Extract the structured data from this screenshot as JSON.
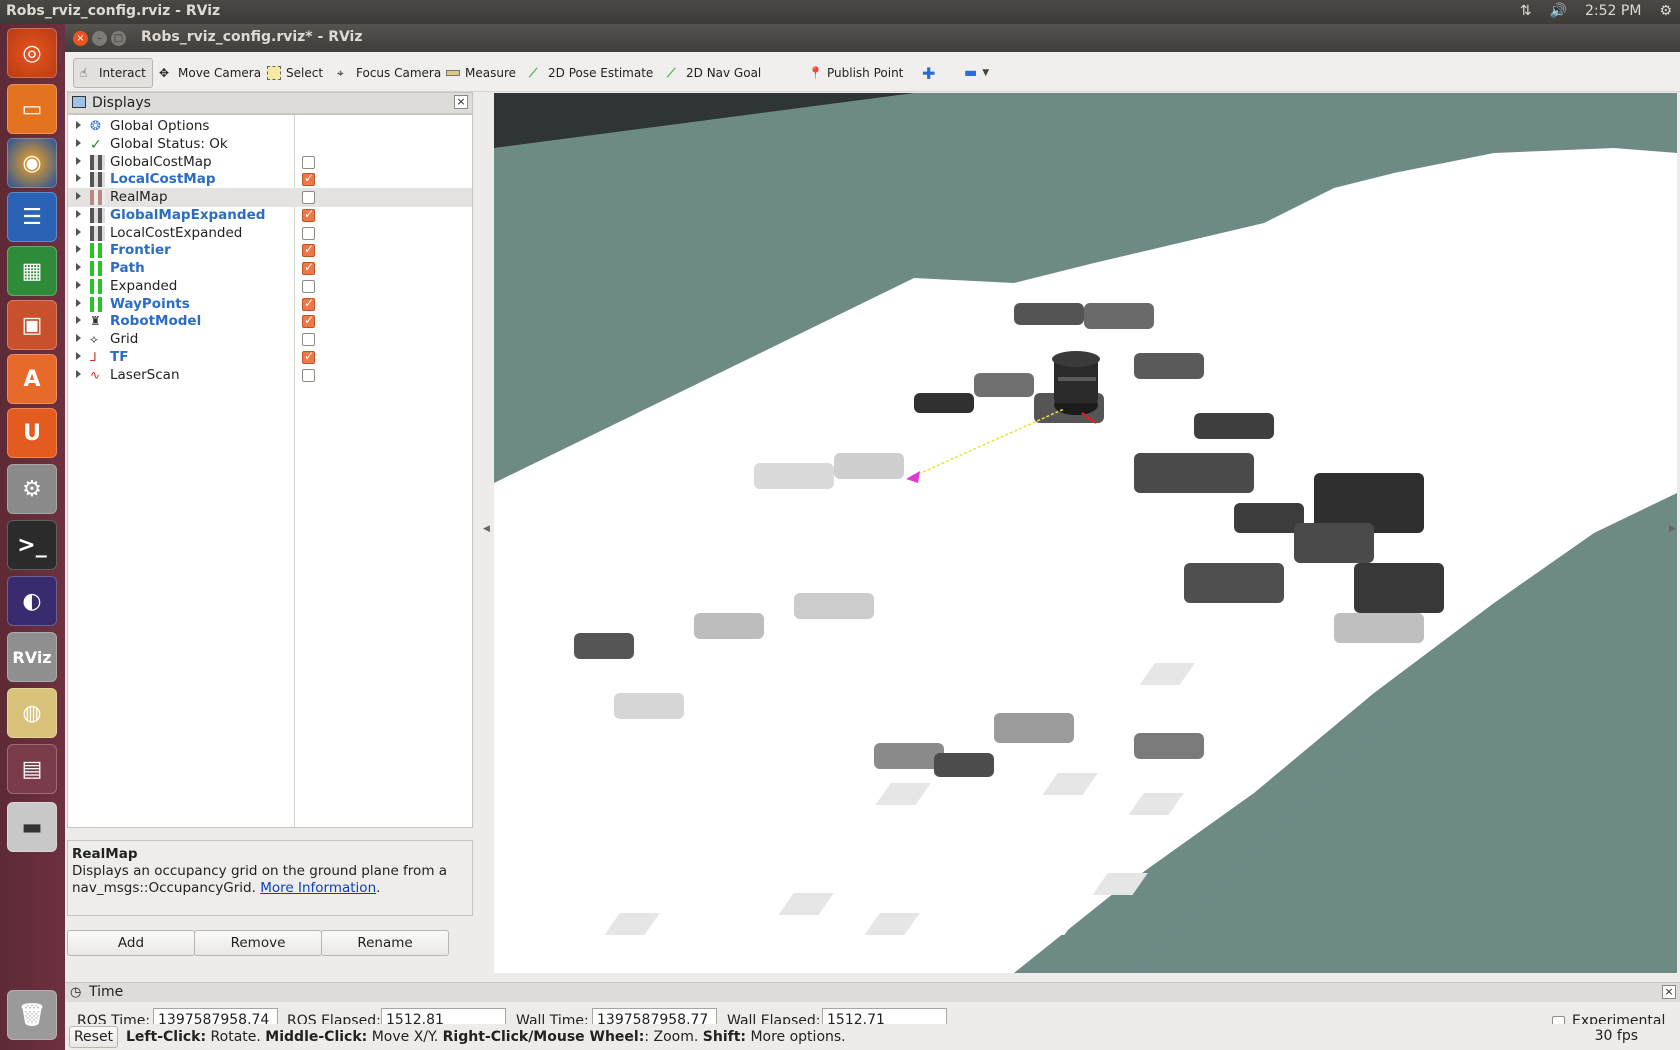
{
  "topbar": {
    "title": "Robs_rviz_config.rviz - RViz",
    "time": "2:52 PM"
  },
  "window": {
    "title": "Robs_rviz_config.rviz* - RViz"
  },
  "toolbar": {
    "interact": "Interact",
    "move_camera": "Move Camera",
    "select": "Select",
    "focus_camera": "Focus Camera",
    "measure": "Measure",
    "pose_estimate": "2D Pose Estimate",
    "nav_goal": "2D Nav Goal",
    "publish_point": "Publish Point"
  },
  "displays": {
    "title": "Displays",
    "items": [
      {
        "label": "Global Options",
        "icon": "gear-icon",
        "checkbox": null,
        "enabled": false
      },
      {
        "label": "Global Status: Ok",
        "icon": "check-icon",
        "checkbox": null,
        "enabled": false
      },
      {
        "label": "GlobalCostMap",
        "icon": "grid-map-icon",
        "checkbox": false,
        "enabled": false
      },
      {
        "label": "LocalCostMap",
        "icon": "grid-map-icon",
        "checkbox": true,
        "enabled": true
      },
      {
        "label": "RealMap",
        "icon": "map-icon",
        "checkbox": false,
        "enabled": false,
        "selected": true
      },
      {
        "label": "GlobalMapExpanded",
        "icon": "grid-map-icon",
        "checkbox": true,
        "enabled": true
      },
      {
        "label": "LocalCostExpanded",
        "icon": "grid-map-icon",
        "checkbox": false,
        "enabled": false
      },
      {
        "label": "Frontier",
        "icon": "grid-cells-icon",
        "checkbox": true,
        "enabled": true
      },
      {
        "label": "Path",
        "icon": "grid-cells-icon",
        "checkbox": true,
        "enabled": true
      },
      {
        "label": "Expanded",
        "icon": "grid-cells-icon",
        "checkbox": false,
        "enabled": false
      },
      {
        "label": "WayPoints",
        "icon": "grid-cells-icon",
        "checkbox": true,
        "enabled": true
      },
      {
        "label": "RobotModel",
        "icon": "robot-icon",
        "checkbox": true,
        "enabled": true
      },
      {
        "label": "Grid",
        "icon": "grid-icon",
        "checkbox": false,
        "enabled": false
      },
      {
        "label": "TF",
        "icon": "axes-icon",
        "checkbox": true,
        "enabled": true
      },
      {
        "label": "LaserScan",
        "icon": "laser-icon",
        "checkbox": false,
        "enabled": false
      }
    ],
    "description": {
      "title": "RealMap",
      "text": "Displays an occupancy grid on the ground plane from a nav_msgs::OccupancyGrid.",
      "link": "More Information"
    },
    "buttons": {
      "add": "Add",
      "remove": "Remove",
      "rename": "Rename"
    }
  },
  "time": {
    "title": "Time",
    "ros_time_label": "ROS Time:",
    "ros_time": "1397587958.74",
    "ros_elapsed_label": "ROS Elapsed:",
    "ros_elapsed": "1512.81",
    "wall_time_label": "Wall Time:",
    "wall_time": "1397587958.77",
    "wall_elapsed_label": "Wall Elapsed:",
    "wall_elapsed": "1512.71",
    "experimental": "Experimental"
  },
  "status": {
    "reset": "Reset",
    "left_click": "Left-Click:",
    "left_click_text": "Rotate.",
    "middle_click": "Middle-Click:",
    "middle_click_text": "Move X/Y.",
    "right_click": "Right-Click/Mouse Wheel:",
    "right_click_text": ": Zoom.",
    "shift": "Shift:",
    "shift_text": "More options.",
    "fps": "30 fps"
  },
  "colors": {
    "map_unknown": "#6d8a85",
    "map_free": "#ffffff",
    "accent_checkbox": "#f07746",
    "enabled_text": "#2b6cc4"
  }
}
